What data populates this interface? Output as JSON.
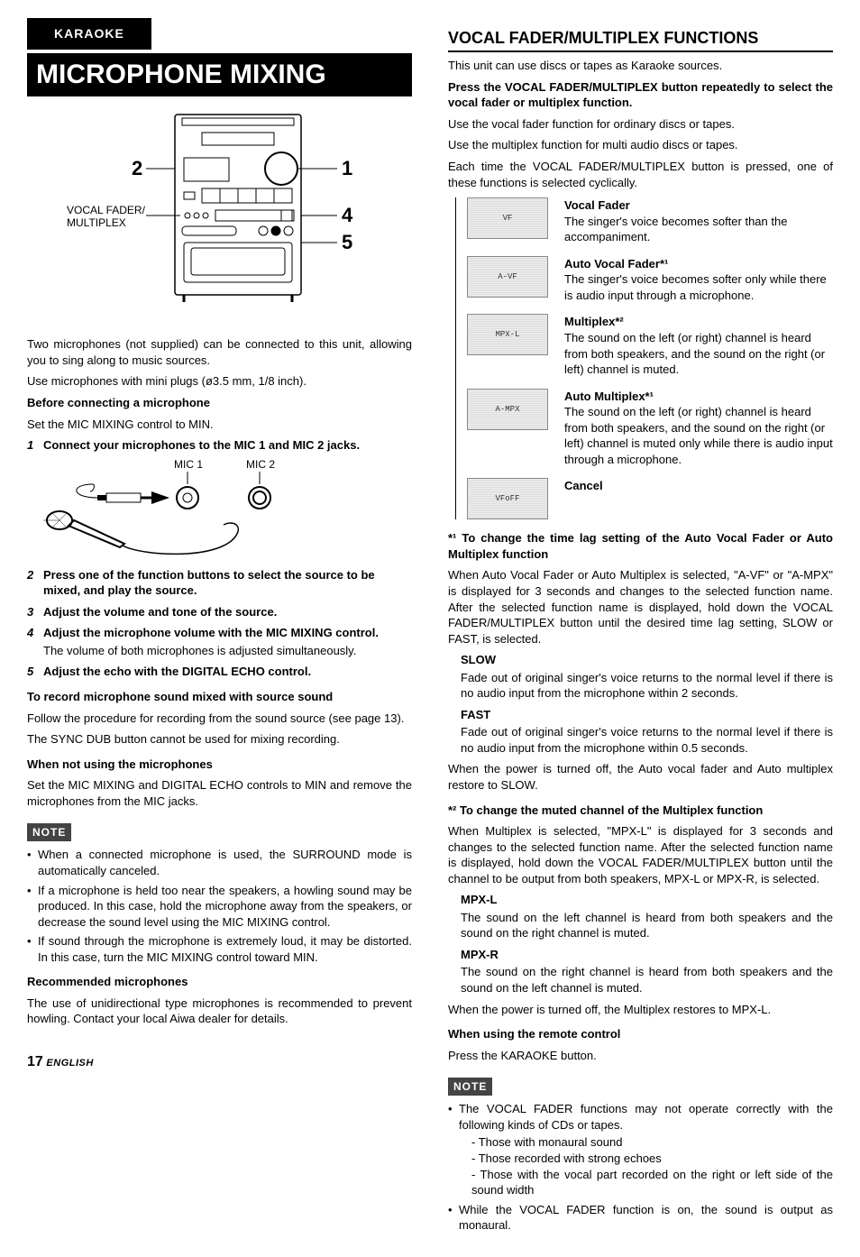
{
  "tab": "KARAOKE",
  "left": {
    "title": "MICROPHONE MIXING",
    "diagram": {
      "callout1": "1",
      "callout2": "2",
      "callout4": "4",
      "callout5": "5",
      "labelVF": "VOCAL FADER/\nMULTIPLEX"
    },
    "intro1": "Two microphones (not supplied) can be connected to this unit, allowing you to sing along to music sources.",
    "intro2": "Use microphones with mini plugs (ø3.5 mm, 1/8 inch).",
    "before_h": "Before connecting a microphone",
    "before_b": "Set the MIC MIXING control to MIN.",
    "step1_h": "Connect your microphones to the MIC 1 and MIC 2 jacks.",
    "micdia": {
      "mic1": "MIC 1",
      "mic2": "MIC 2"
    },
    "step2": "Press one of the function buttons to select the source to be mixed, and play the source.",
    "step3": "Adjust the volume and tone of the source.",
    "step4_h": "Adjust the microphone volume with the MIC MIXING control.",
    "step4_b": "The volume of both microphones is adjusted simultaneously.",
    "step5": "Adjust the echo with the DIGITAL ECHO control.",
    "record_h": "To record microphone sound mixed with source sound",
    "record_b1": "Follow the procedure for recording from the sound source (see page 13).",
    "record_b2": "The SYNC DUB button cannot be used for mixing recording.",
    "notusing_h": "When not using the microphones",
    "notusing_b": "Set the MIC MIXING and DIGITAL ECHO controls to MIN and remove the microphones from the MIC jacks.",
    "note_label": "NOTE",
    "note_items": [
      "When a connected microphone is used, the SURROUND mode is automatically canceled.",
      "If a microphone is held too near the speakers, a howling sound may be produced. In this case, hold the microphone away from the speakers, or decrease the sound level using the MIC MIXING control.",
      "If sound through the microphone is extremely loud, it may be distorted. In this case, turn the MIC MIXING control toward MIN."
    ],
    "recmic_h": "Recommended microphones",
    "recmic_b": "The use of unidirectional type microphones is recommended to prevent howling. Contact your local Aiwa dealer for details."
  },
  "right": {
    "title": "VOCAL FADER/MULTIPLEX FUNCTIONS",
    "intro": "This unit can use discs or tapes as Karaoke sources.",
    "press_h": "Press the VOCAL FADER/MULTIPLEX button repeatedly to select the vocal fader or multiplex function.",
    "press_b1": "Use the vocal fader function for ordinary discs or tapes.",
    "press_b2": "Use the multiplex function for multi audio discs or tapes.",
    "press_b3": "Each time the VOCAL FADER/MULTIPLEX button is pressed, one of these functions is selected cyclically.",
    "modes": [
      {
        "icon": "VF",
        "h": "Vocal Fader",
        "b": "The singer's voice becomes softer than the accompaniment."
      },
      {
        "icon": "A-VF",
        "h": "Auto Vocal Fader*¹",
        "b": "The singer's voice becomes softer only while there is audio input through a microphone."
      },
      {
        "icon": "MPX-L",
        "h": "Multiplex*²",
        "b": "The sound on the left (or right) channel is heard from both speakers, and the sound on the right (or left) channel is muted."
      },
      {
        "icon": "A-MPX",
        "h": "Auto Multiplex*¹",
        "b": "The sound on the left (or right) channel is heard from both speakers, and the sound on the right (or left) channel is muted only while there is audio input through a microphone."
      },
      {
        "icon": "VFoFF",
        "h": "Cancel",
        "b": ""
      }
    ],
    "fn1_h": "*¹ To change the time lag setting of the Auto Vocal Fader or Auto Multiplex function",
    "fn1_b": "When Auto Vocal Fader or Auto Multiplex is selected, \"A-VF\" or \"A-MPX\" is displayed for 3 seconds and changes to the selected function name. After the selected function name is displayed, hold down the VOCAL FADER/MULTIPLEX button until the desired time lag setting, SLOW or FAST, is selected.",
    "slow_h": "SLOW",
    "slow_b": "Fade out of original singer's voice returns to the normal level if there is no audio input from the microphone within 2 seconds.",
    "fast_h": "FAST",
    "fast_b": "Fade out of original singer's voice returns to the normal level if there is no audio input from the microphone within 0.5 seconds.",
    "fn1_b2": "When the power is turned off, the Auto vocal fader and Auto multiplex restore to SLOW.",
    "fn2_h": "*² To change the muted channel of the Multiplex function",
    "fn2_b": "When Multiplex is selected, \"MPX-L\" is displayed for 3 seconds and changes to the selected function name. After the selected function name is displayed, hold down the VOCAL FADER/MULTIPLEX button until the channel to be output from both speakers, MPX-L or MPX-R, is selected.",
    "mpxl_h": "MPX-L",
    "mpxl_b": "The sound on the left channel is heard from both speakers and the sound on the right channel is muted.",
    "mpxr_h": "MPX-R",
    "mpxr_b": "The sound on the right channel is heard from both speakers and the sound on the left channel is muted.",
    "fn2_b2": "When the power is turned off, the Multiplex restores to MPX-L.",
    "remote_h": "When using the remote control",
    "remote_b": "Press the KARAOKE button.",
    "note_label": "NOTE",
    "note_lead": "The VOCAL FADER functions may not operate correctly with the following kinds of CDs or tapes.",
    "note_dashes": [
      "Those with monaural sound",
      "Those recorded with strong echoes",
      "Those with the vocal part recorded on the right or left side of the sound width"
    ],
    "note_item2": "While the VOCAL FADER function is on, the sound is output as monaural."
  },
  "footer": {
    "page": "17",
    "lang": "ENGLISH"
  }
}
